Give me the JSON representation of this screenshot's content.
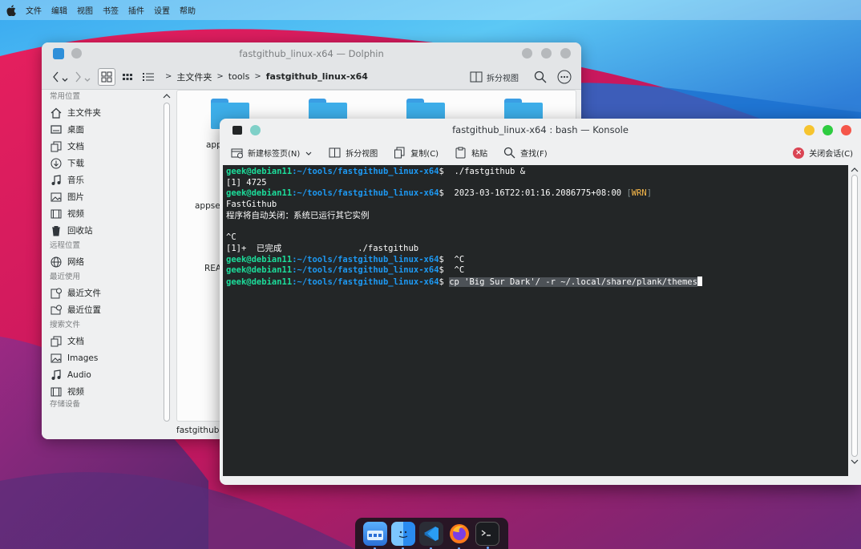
{
  "menubar": {
    "items": [
      "文件",
      "编辑",
      "视图",
      "书签",
      "插件",
      "设置",
      "帮助"
    ]
  },
  "dolphin": {
    "title": "fastgithub_linux-x64 — Dolphin",
    "breadcrumb": [
      "主文件夹",
      "tools",
      "fastgithub_linux-x64"
    ],
    "split_view": "拆分视图",
    "sidebar": {
      "sections": [
        {
          "title": "常用位置",
          "items": [
            {
              "label": "主文件夹",
              "icon": "home-icon"
            },
            {
              "label": "桌面",
              "icon": "desktop-icon"
            },
            {
              "label": "文档",
              "icon": "documents-icon"
            },
            {
              "label": "下载",
              "icon": "download-icon"
            },
            {
              "label": "音乐",
              "icon": "music-icon"
            },
            {
              "label": "图片",
              "icon": "pictures-icon"
            },
            {
              "label": "视频",
              "icon": "videos-icon"
            },
            {
              "label": "回收站",
              "icon": "trash-icon"
            }
          ]
        },
        {
          "title": "远程位置",
          "items": [
            {
              "label": "网络",
              "icon": "network-icon"
            }
          ]
        },
        {
          "title": "最近使用",
          "items": [
            {
              "label": "最近文件",
              "icon": "recent-files-icon"
            },
            {
              "label": "最近位置",
              "icon": "recent-locations-icon"
            }
          ]
        },
        {
          "title": "搜索文件",
          "items": [
            {
              "label": "文档",
              "icon": "documents-icon"
            },
            {
              "label": "Images",
              "icon": "images-icon"
            },
            {
              "label": "Audio",
              "icon": "audio-icon"
            },
            {
              "label": "视频",
              "icon": "videos-icon"
            }
          ]
        },
        {
          "title": "存储设备",
          "items": []
        }
      ]
    },
    "files": [
      "app",
      "appse",
      "REA"
    ],
    "status": "fastgithub"
  },
  "konsole": {
    "title": "fastgithub_linux-x64 : bash — Konsole",
    "toolbar": {
      "new_tab": "新建标签页(N)",
      "split": "拆分视图",
      "copy": "复制(C)",
      "paste": "粘贴",
      "find": "查找(F)",
      "close_session": "关闭会话(C)"
    },
    "prompt_user": "geek@debian11",
    "prompt_path": "~/tools/fastgithub_linux-x64",
    "lines": [
      {
        "type": "prompt",
        "cmd": " ./fastgithub &"
      },
      {
        "type": "text",
        "text": "[1] 4725"
      },
      {
        "type": "prompt_warn",
        "cmd": " 2023-03-16T22:01:16.2086775+08:00 ",
        "warn": "WRN"
      },
      {
        "type": "text",
        "text": "FastGithub"
      },
      {
        "type": "text",
        "text": "程序将自动关闭：系统已运行其它实例"
      },
      {
        "type": "text",
        "text": ""
      },
      {
        "type": "text",
        "text": "^C"
      },
      {
        "type": "text",
        "text": "[1]+  已完成               ./fastgithub"
      },
      {
        "type": "prompt",
        "cmd": " ^C"
      },
      {
        "type": "prompt",
        "cmd": " ^C"
      },
      {
        "type": "prompt_sel",
        "cmd": "cp 'Big Sur Dark'/ -r ~/.local/share/plank/themes"
      }
    ]
  },
  "dock": {
    "apps": [
      "file-manager-icon",
      "finder-icon",
      "vscode-icon",
      "firefox-icon",
      "terminal-icon"
    ]
  }
}
